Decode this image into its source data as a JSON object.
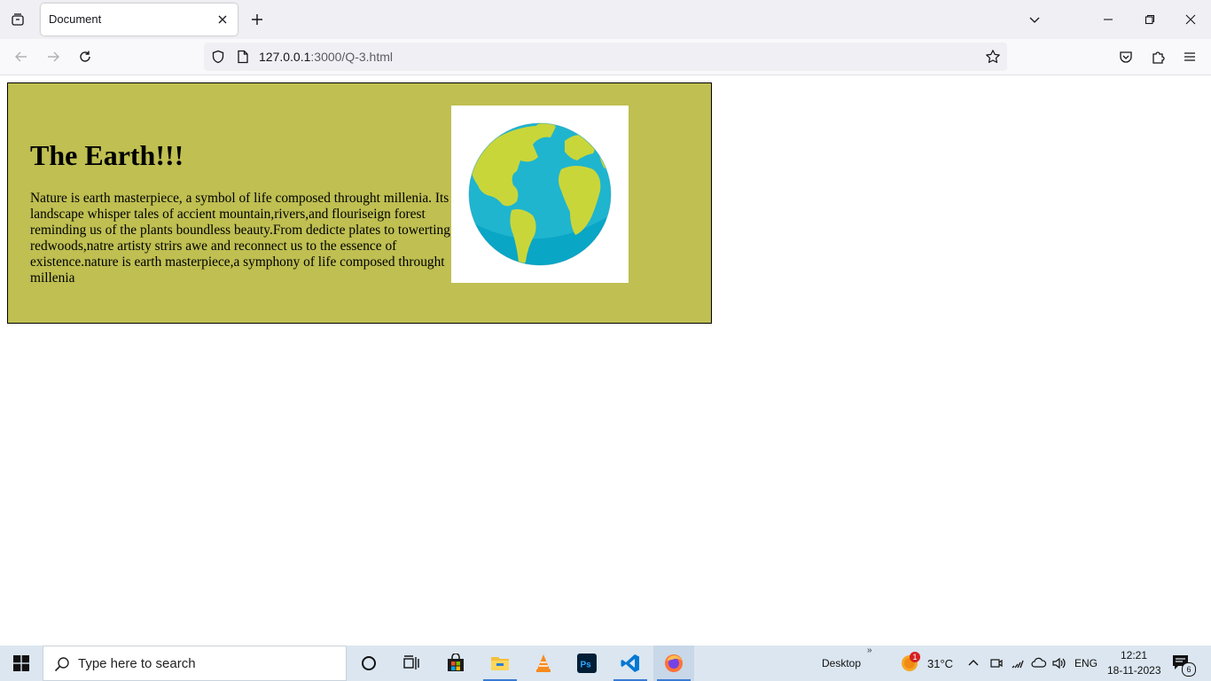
{
  "browser": {
    "tab_title": "Document",
    "url_host": "127.0.0.1",
    "url_rest": ":3000/Q-3.html"
  },
  "page": {
    "heading": "The Earth!!!",
    "paragraph": "Nature is earth masterpiece, a symbol of life composed throught millenia. Its landscape whisper tales of accient mountain,rivers,and flouriseign forest reminding us of the plants boundless beauty.From dedicte plates to towerting redwoods,natre artisty strirs awe and reconnect us to the essence of existence.nature is earth masterpiece,a symphony of life composed throught millenia",
    "image_icon": "earth-globe-icon",
    "card_color": "#bfbf52"
  },
  "taskbar": {
    "search_placeholder": "Type here to search",
    "desktop_label": "Desktop",
    "weather_temp": "31°C",
    "weather_badge": "1",
    "language": "ENG",
    "time": "12:21",
    "date": "18-11-2023",
    "notification_count": "6"
  }
}
